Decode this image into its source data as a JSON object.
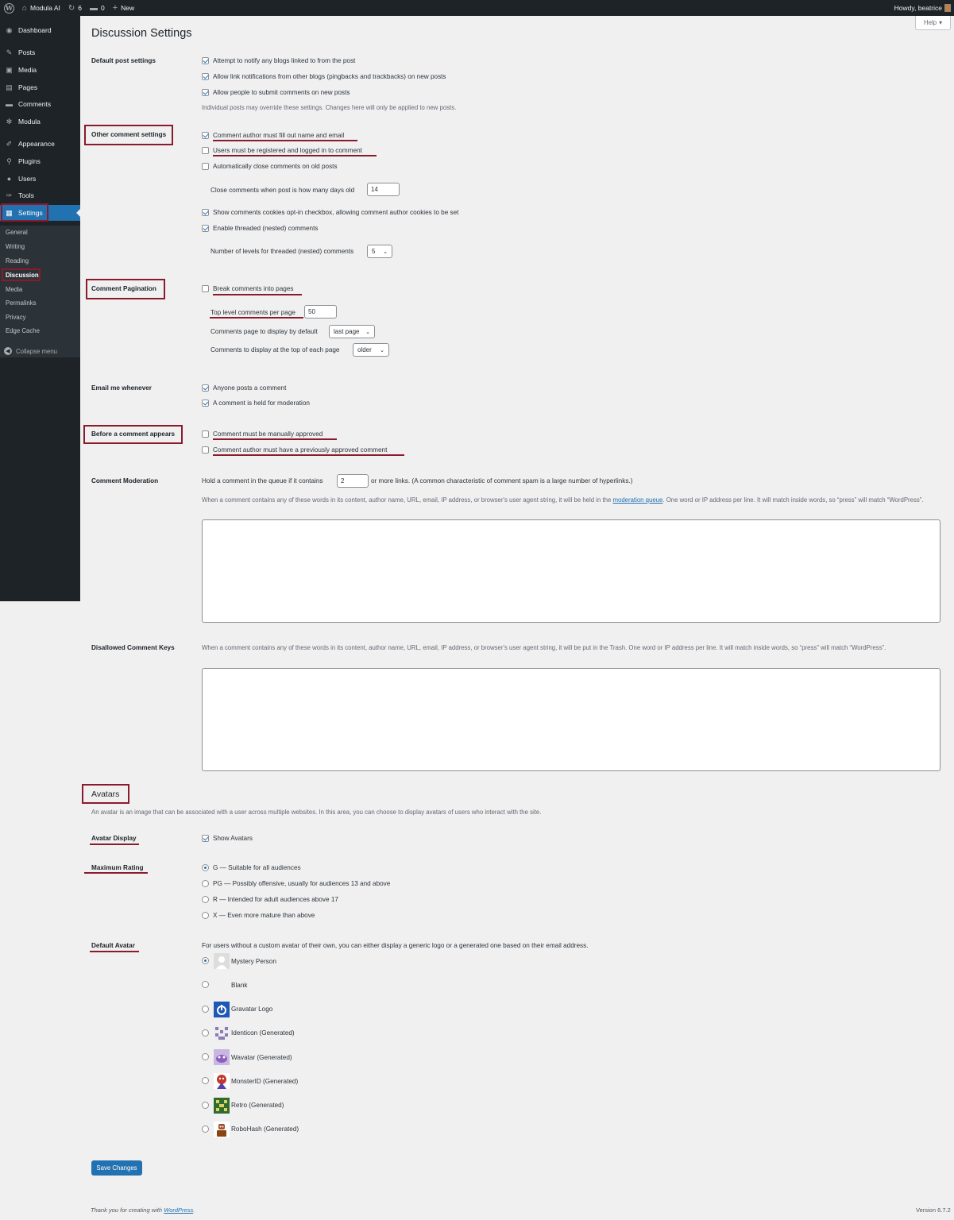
{
  "adminbar": {
    "wp_logo": "W",
    "site_name": "Modula AI",
    "updates_count": "6",
    "comments_count": "0",
    "new_label": "New",
    "howdy": "Howdy, beatrice"
  },
  "sidebar": {
    "items": [
      {
        "label": "Dashboard",
        "icon": "dashboard-icon",
        "glyph": "◉"
      },
      {
        "label": "Posts",
        "icon": "pin-icon",
        "glyph": "✎"
      },
      {
        "label": "Media",
        "icon": "media-icon",
        "glyph": "▣"
      },
      {
        "label": "Pages",
        "icon": "pages-icon",
        "glyph": "▤"
      },
      {
        "label": "Comments",
        "icon": "comments-icon",
        "glyph": "▬"
      },
      {
        "label": "Modula",
        "icon": "modula-icon",
        "glyph": "✻"
      },
      {
        "label": "Appearance",
        "icon": "appearance-icon",
        "glyph": "✐"
      },
      {
        "label": "Plugins",
        "icon": "plugins-icon",
        "glyph": "⚲"
      },
      {
        "label": "Users",
        "icon": "users-icon",
        "glyph": "●"
      },
      {
        "label": "Tools",
        "icon": "tools-icon",
        "glyph": "✑"
      },
      {
        "label": "Settings",
        "icon": "settings-icon",
        "glyph": "▦"
      }
    ],
    "submenu": [
      "General",
      "Writing",
      "Reading",
      "Discussion",
      "Media",
      "Permalinks",
      "Privacy",
      "Edge Cache"
    ],
    "collapse": "Collapse menu"
  },
  "page": {
    "title": "Discussion Settings",
    "help": "Help"
  },
  "default_post": {
    "heading": "Default post settings",
    "opts": [
      "Attempt to notify any blogs linked to from the post",
      "Allow link notifications from other blogs (pingbacks and trackbacks) on new posts",
      "Allow people to submit comments on new posts"
    ],
    "note": "Individual posts may override these settings. Changes here will only be applied to new posts."
  },
  "other_comment": {
    "heading": "Other comment settings",
    "opts": [
      "Comment author must fill out name and email",
      "Users must be registered and logged in to comment",
      "Automatically close comments on old posts"
    ],
    "close_label": "Close comments when post is how many days old",
    "close_days": "14",
    "cookies": "Show comments cookies opt-in checkbox, allowing comment author cookies to be set",
    "threaded": "Enable threaded (nested) comments",
    "levels_label": "Number of levels for threaded (nested) comments",
    "levels": "5"
  },
  "pagination": {
    "heading": "Comment Pagination",
    "break": "Break comments into pages",
    "per_page_label": "Top level comments per page",
    "per_page": "50",
    "default_page_label": "Comments page to display by default",
    "default_page": "last page",
    "top_label": "Comments to display at the top of each page",
    "top": "older"
  },
  "email": {
    "heading": "Email me whenever",
    "opts": [
      "Anyone posts a comment",
      "A comment is held for moderation"
    ]
  },
  "before": {
    "heading": "Before a comment appears",
    "opts": [
      "Comment must be manually approved",
      "Comment author must have a previously approved comment"
    ]
  },
  "moderation": {
    "heading": "Comment Moderation",
    "hold_prefix": "Hold a comment in the queue if it contains",
    "links": "2",
    "hold_suffix": "or more links. (A common characteristic of comment spam is a large number of hyperlinks.)",
    "desc_1": "When a comment contains any of these words in its content, author name, URL, email, IP address, or browser's user agent string, it will be held in the",
    "queue_link": "moderation queue",
    "desc_2": ". One word or IP address per line. It will match inside words, so “press” will match “WordPress”."
  },
  "disallowed": {
    "heading": "Disallowed Comment Keys",
    "desc": "When a comment contains any of these words in its content, author name, URL, email, IP address, or browser's user agent string, it will be put in the Trash. One word or IP address per line. It will match inside words, so “press” will match “WordPress”."
  },
  "avatars": {
    "heading": "Avatars",
    "intro": "An avatar is an image that can be associated with a user across multiple websites. In this area, you can choose to display avatars of users who interact with the site.",
    "display_heading": "Avatar Display",
    "show": "Show Avatars",
    "rating_heading": "Maximum Rating",
    "ratings": [
      "G — Suitable for all audiences",
      "PG — Possibly offensive, usually for audiences 13 and above",
      "R — Intended for adult audiences above 17",
      "X — Even more mature than above"
    ],
    "default_heading": "Default Avatar",
    "default_desc": "For users without a custom avatar of their own, you can either display a generic logo or a generated one based on their email address.",
    "options": [
      {
        "label": "Mystery Person",
        "icon": "mystery-person-avatar"
      },
      {
        "label": "Blank",
        "icon": "blank-avatar"
      },
      {
        "label": "Gravatar Logo",
        "icon": "gravatar-logo-avatar"
      },
      {
        "label": "Identicon (Generated)",
        "icon": "identicon-avatar"
      },
      {
        "label": "Wavatar (Generated)",
        "icon": "wavatar-avatar"
      },
      {
        "label": "MonsterID (Generated)",
        "icon": "monsterid-avatar"
      },
      {
        "label": "Retro (Generated)",
        "icon": "retro-avatar"
      },
      {
        "label": "RoboHash (Generated)",
        "icon": "robohash-avatar"
      }
    ]
  },
  "save": "Save Changes",
  "footer": {
    "thanks": "Thank you for creating with",
    "link": "WordPress",
    "dot": ".",
    "version": "Version 6.7.2"
  },
  "colors": {
    "accent": "#2271b1",
    "annotation": "#8b1a2b",
    "sidebar": "#1d2327"
  }
}
